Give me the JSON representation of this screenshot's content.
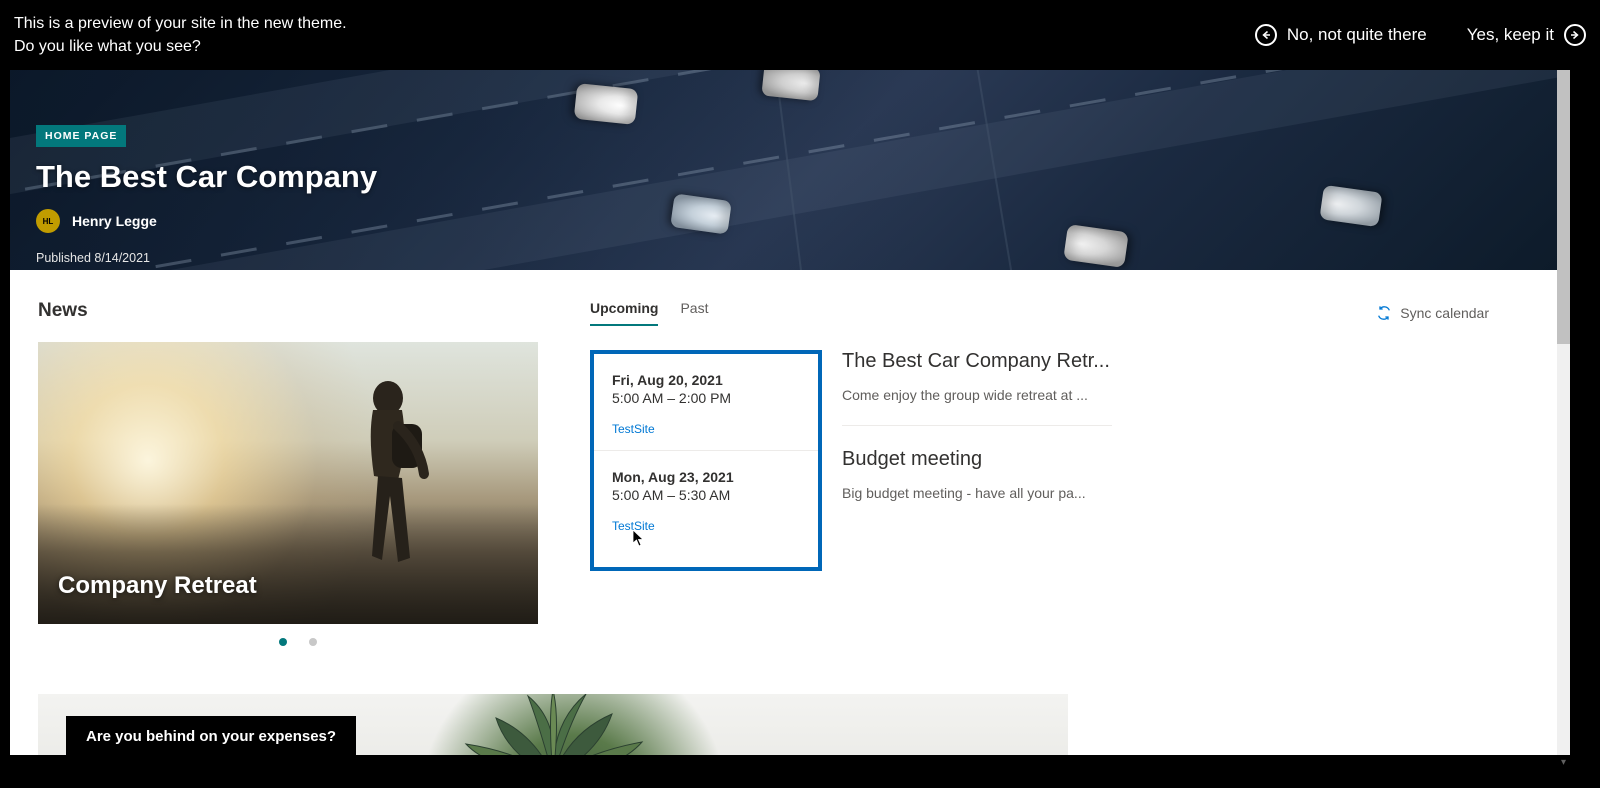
{
  "topbar": {
    "line1": "This is a preview of your site in the new theme.",
    "line2": "Do you like what you see?",
    "no_label": "No, not quite there",
    "yes_label": "Yes, keep it"
  },
  "hero": {
    "badge": "HOME PAGE",
    "title": "The Best Car Company",
    "author_initials": "HL",
    "author_name": "Henry Legge",
    "published": "Published 8/14/2021"
  },
  "news": {
    "section_title": "News",
    "card_title": "Company Retreat"
  },
  "events": {
    "tabs": {
      "upcoming": "Upcoming",
      "past": "Past"
    },
    "sync_label": "Sync calendar",
    "items": [
      {
        "date_line": "Fri, Aug 20, 2021",
        "time_line": "5:00 AM – 2:00 PM",
        "site": "TestSite",
        "title": "The Best Car Company Retr...",
        "desc": "Come enjoy the group wide retreat at ..."
      },
      {
        "date_line": "Mon, Aug 23, 2021",
        "time_line": "5:00 AM – 5:30 AM",
        "site": "TestSite",
        "title": "Budget meeting",
        "desc": "Big budget meeting - have all your pa..."
      }
    ]
  },
  "lower": {
    "headline": "Are you behind on your expenses?"
  },
  "colors": {
    "accent": "#03787c",
    "link": "#0078d4",
    "highlight_border": "#0067b8"
  }
}
